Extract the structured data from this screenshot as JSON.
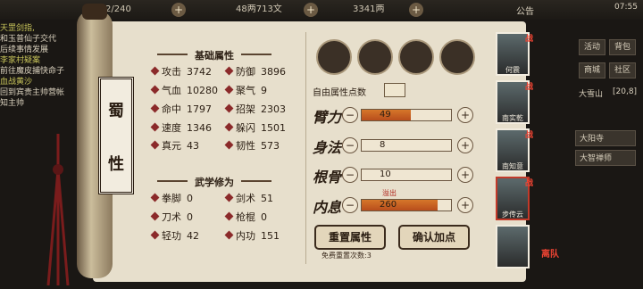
{
  "topbar": {
    "stamina": "2/240",
    "money": "48两713文",
    "ingots": "3341两",
    "announce": "公告",
    "clock": "07:55"
  },
  "quests": [
    {
      "title": "天罡剑指,",
      "desc": "和玉普仙子交代"
    },
    {
      "title": "",
      "desc": "后续事情发展"
    },
    {
      "title": "李家村疑案",
      "desc": "前往魔皮捕快命子"
    },
    {
      "title": "血战黄沙",
      "desc": "回到宾贵主帅营帐"
    },
    {
      "title": "",
      "desc": "知主帅"
    }
  ],
  "character": {
    "name_1": "蜀",
    "name_2": "性"
  },
  "basic": {
    "header": "基础属性",
    "left": [
      {
        "label": "攻击",
        "value": "3742"
      },
      {
        "label": "气血",
        "value": "10280"
      },
      {
        "label": "命中",
        "value": "1797"
      },
      {
        "label": "速度",
        "value": "1346"
      },
      {
        "label": "真元",
        "value": "43"
      }
    ],
    "right": [
      {
        "label": "防御",
        "value": "3896"
      },
      {
        "label": "聚气",
        "value": "9"
      },
      {
        "label": "招架",
        "value": "2303"
      },
      {
        "label": "躲闪",
        "value": "1501"
      },
      {
        "label": "韧性",
        "value": "573"
      }
    ]
  },
  "martial": {
    "header": "武学修为",
    "left": [
      {
        "label": "拳脚",
        "value": "0"
      },
      {
        "label": "刀术",
        "value": "0"
      },
      {
        "label": "轻功",
        "value": "42"
      }
    ],
    "right": [
      {
        "label": "剑术",
        "value": "51"
      },
      {
        "label": "枪棍",
        "value": "0"
      },
      {
        "label": "内功",
        "value": "151"
      }
    ]
  },
  "points": {
    "free_label": "自由属性点数",
    "overflow": "溢出",
    "attrs": [
      {
        "label": "臂力",
        "value": "49",
        "fill": 0.55
      },
      {
        "label": "身法",
        "value": "8",
        "fill": 0.0
      },
      {
        "label": "根骨",
        "value": "10",
        "fill": 0.0
      },
      {
        "label": "内息",
        "value": "260",
        "fill": 0.85
      }
    ],
    "minus": "−",
    "plus": "+"
  },
  "buttons": {
    "reset": "重置属性",
    "confirm": "确认加点",
    "reset_count": "免费重置次数:3"
  },
  "party": [
    {
      "name": "何震",
      "tag": "战"
    },
    {
      "name": "南实乾",
      "tag": "战"
    },
    {
      "name": "南知意",
      "tag": "战"
    },
    {
      "name": "步传云",
      "tag": "战"
    },
    {
      "name": "",
      "tag": "离队"
    }
  ],
  "menu": {
    "activity": "活动",
    "bag": "背包",
    "shop": "商城",
    "social": "社区",
    "region": "大雪山",
    "coord": "[20,8]",
    "loc1": "大阳寺",
    "loc2": "大智禅师"
  }
}
